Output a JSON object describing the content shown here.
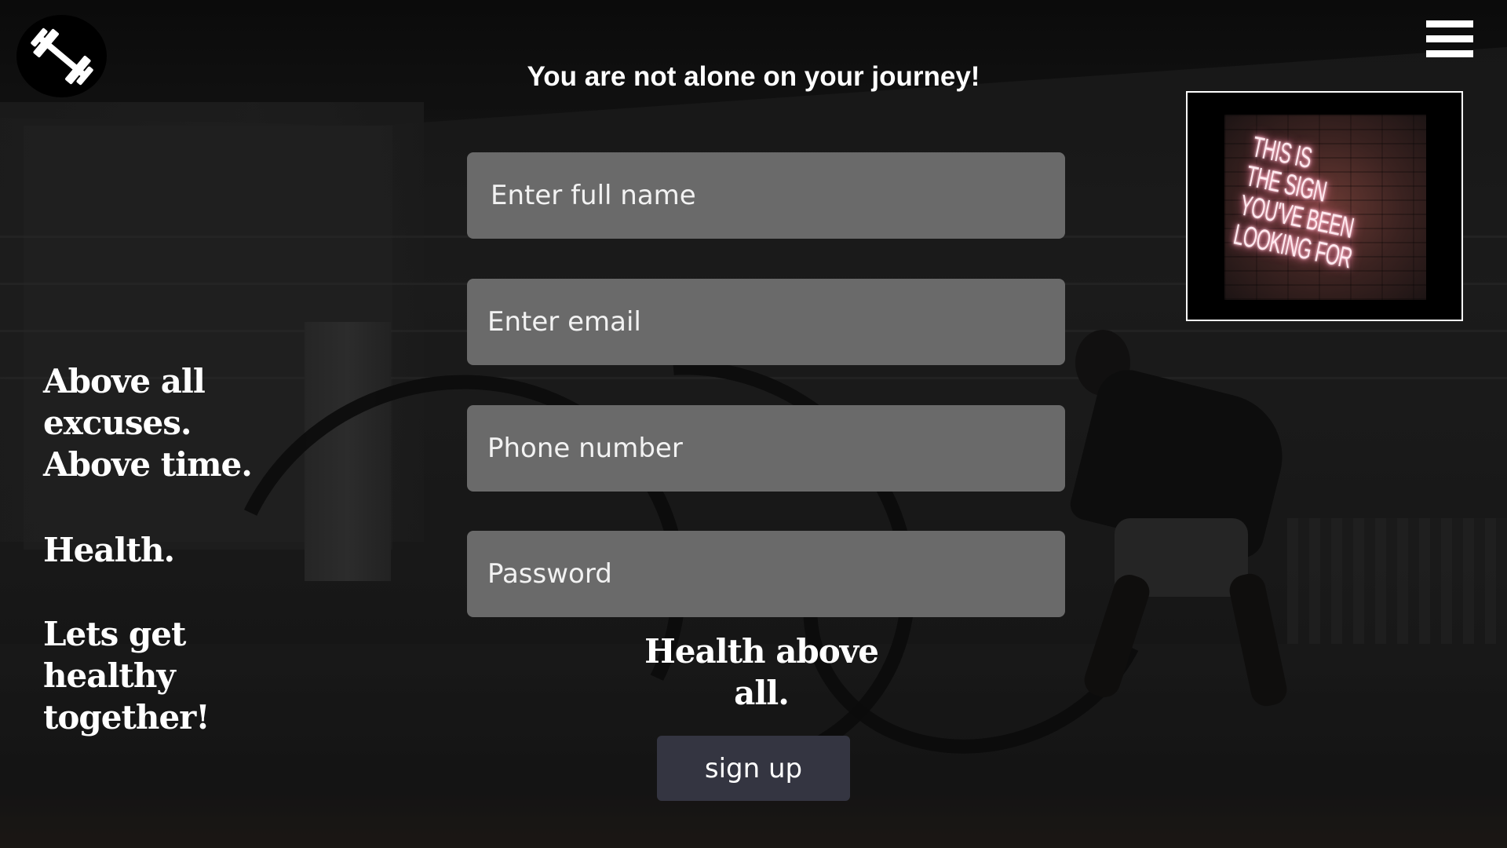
{
  "header": {
    "logo_icon": "dumbbell-icon",
    "menu_icon": "hamburger-menu-icon",
    "title": "You are not alone on your journey!"
  },
  "form": {
    "full_name_placeholder": "Enter full name",
    "email_placeholder": "Enter email",
    "phone_placeholder": "Phone number",
    "password_placeholder": "Password",
    "tagline_line1": "Health above",
    "tagline_line2": "all.",
    "signup_label": "sign up"
  },
  "slogans": {
    "line1": "Above all",
    "line2": "excuses.",
    "line3": "Above time.",
    "line4": "Health.",
    "line5": "Lets get",
    "line6": "healthy",
    "line7": "together!"
  },
  "neon_sign": {
    "line1": "This is",
    "line2": "the sign",
    "line3": "you've been",
    "line4": "looking for"
  },
  "colors": {
    "field_background": "#6a6a6a",
    "button_background": "#343541",
    "text": "#ffffff"
  }
}
